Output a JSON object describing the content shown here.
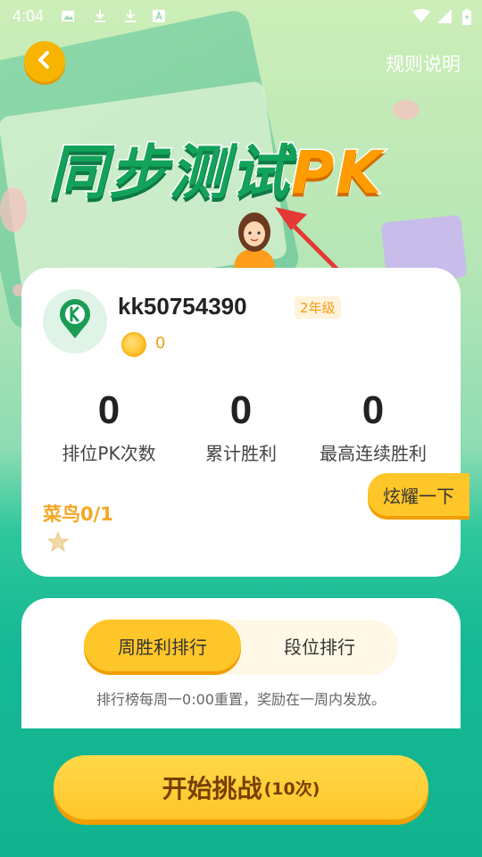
{
  "status_bar": {
    "time": "4:04",
    "icons": [
      "image-icon",
      "download-icon",
      "download-icon",
      "a-icon",
      "wifi-icon",
      "signal-icon",
      "battery-icon"
    ]
  },
  "header": {
    "rules_label": "规则说明",
    "title_cn": "同步测试",
    "title_pk": "PK"
  },
  "profile": {
    "username": "kk50754390",
    "grade": "2年级",
    "coins": "0",
    "stats": [
      {
        "value": "0",
        "label": "排位PK次数"
      },
      {
        "value": "0",
        "label": "累计胜利"
      },
      {
        "value": "0",
        "label": "最高连续胜利"
      }
    ],
    "rank": "菜鸟0/1",
    "show_button": "炫耀一下"
  },
  "ranking": {
    "tabs": [
      {
        "label": "周胜利排行",
        "active": true
      },
      {
        "label": "段位排行",
        "active": false
      }
    ],
    "notice": "排行榜每周一0:00重置，奖励在一周内发放。"
  },
  "start_button": {
    "label": "开始挑战",
    "count": "(10次)"
  },
  "colors": {
    "accent_yellow": "#ffc629",
    "orange": "#f5a623",
    "green": "#13a25a",
    "arrow_red": "#e53935"
  }
}
